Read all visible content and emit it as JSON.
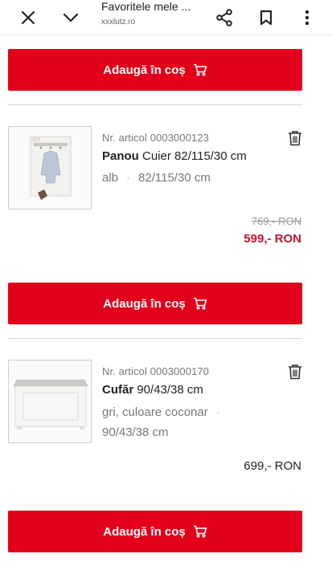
{
  "browser": {
    "title": "Favoritele mele ...",
    "url": "xxxlutz.ro",
    "icons": [
      "close-icon",
      "chevron-down-icon",
      "share-icon",
      "bookmark-icon",
      "more-vert-icon"
    ]
  },
  "add_to_cart_label": "Adaugă în coș",
  "products": [
    {
      "article": "Nr. articol 0003000123",
      "name_bold": "Panou",
      "name_rest": " Cuier 82/115/30 cm",
      "color": "alb",
      "size": "82/115/30 cm",
      "old_price": "769,- RON",
      "price": "599,- RON"
    },
    {
      "article": "Nr. articol 0003000170",
      "name_bold": "Cufăr",
      "name_rest": " 90/43/38 cm",
      "color": "gri, culoare coconar",
      "size": "90/43/38 cm",
      "price": "699,- RON"
    }
  ],
  "colors": {
    "accent": "#e2001a",
    "sale": "#c8102e"
  }
}
